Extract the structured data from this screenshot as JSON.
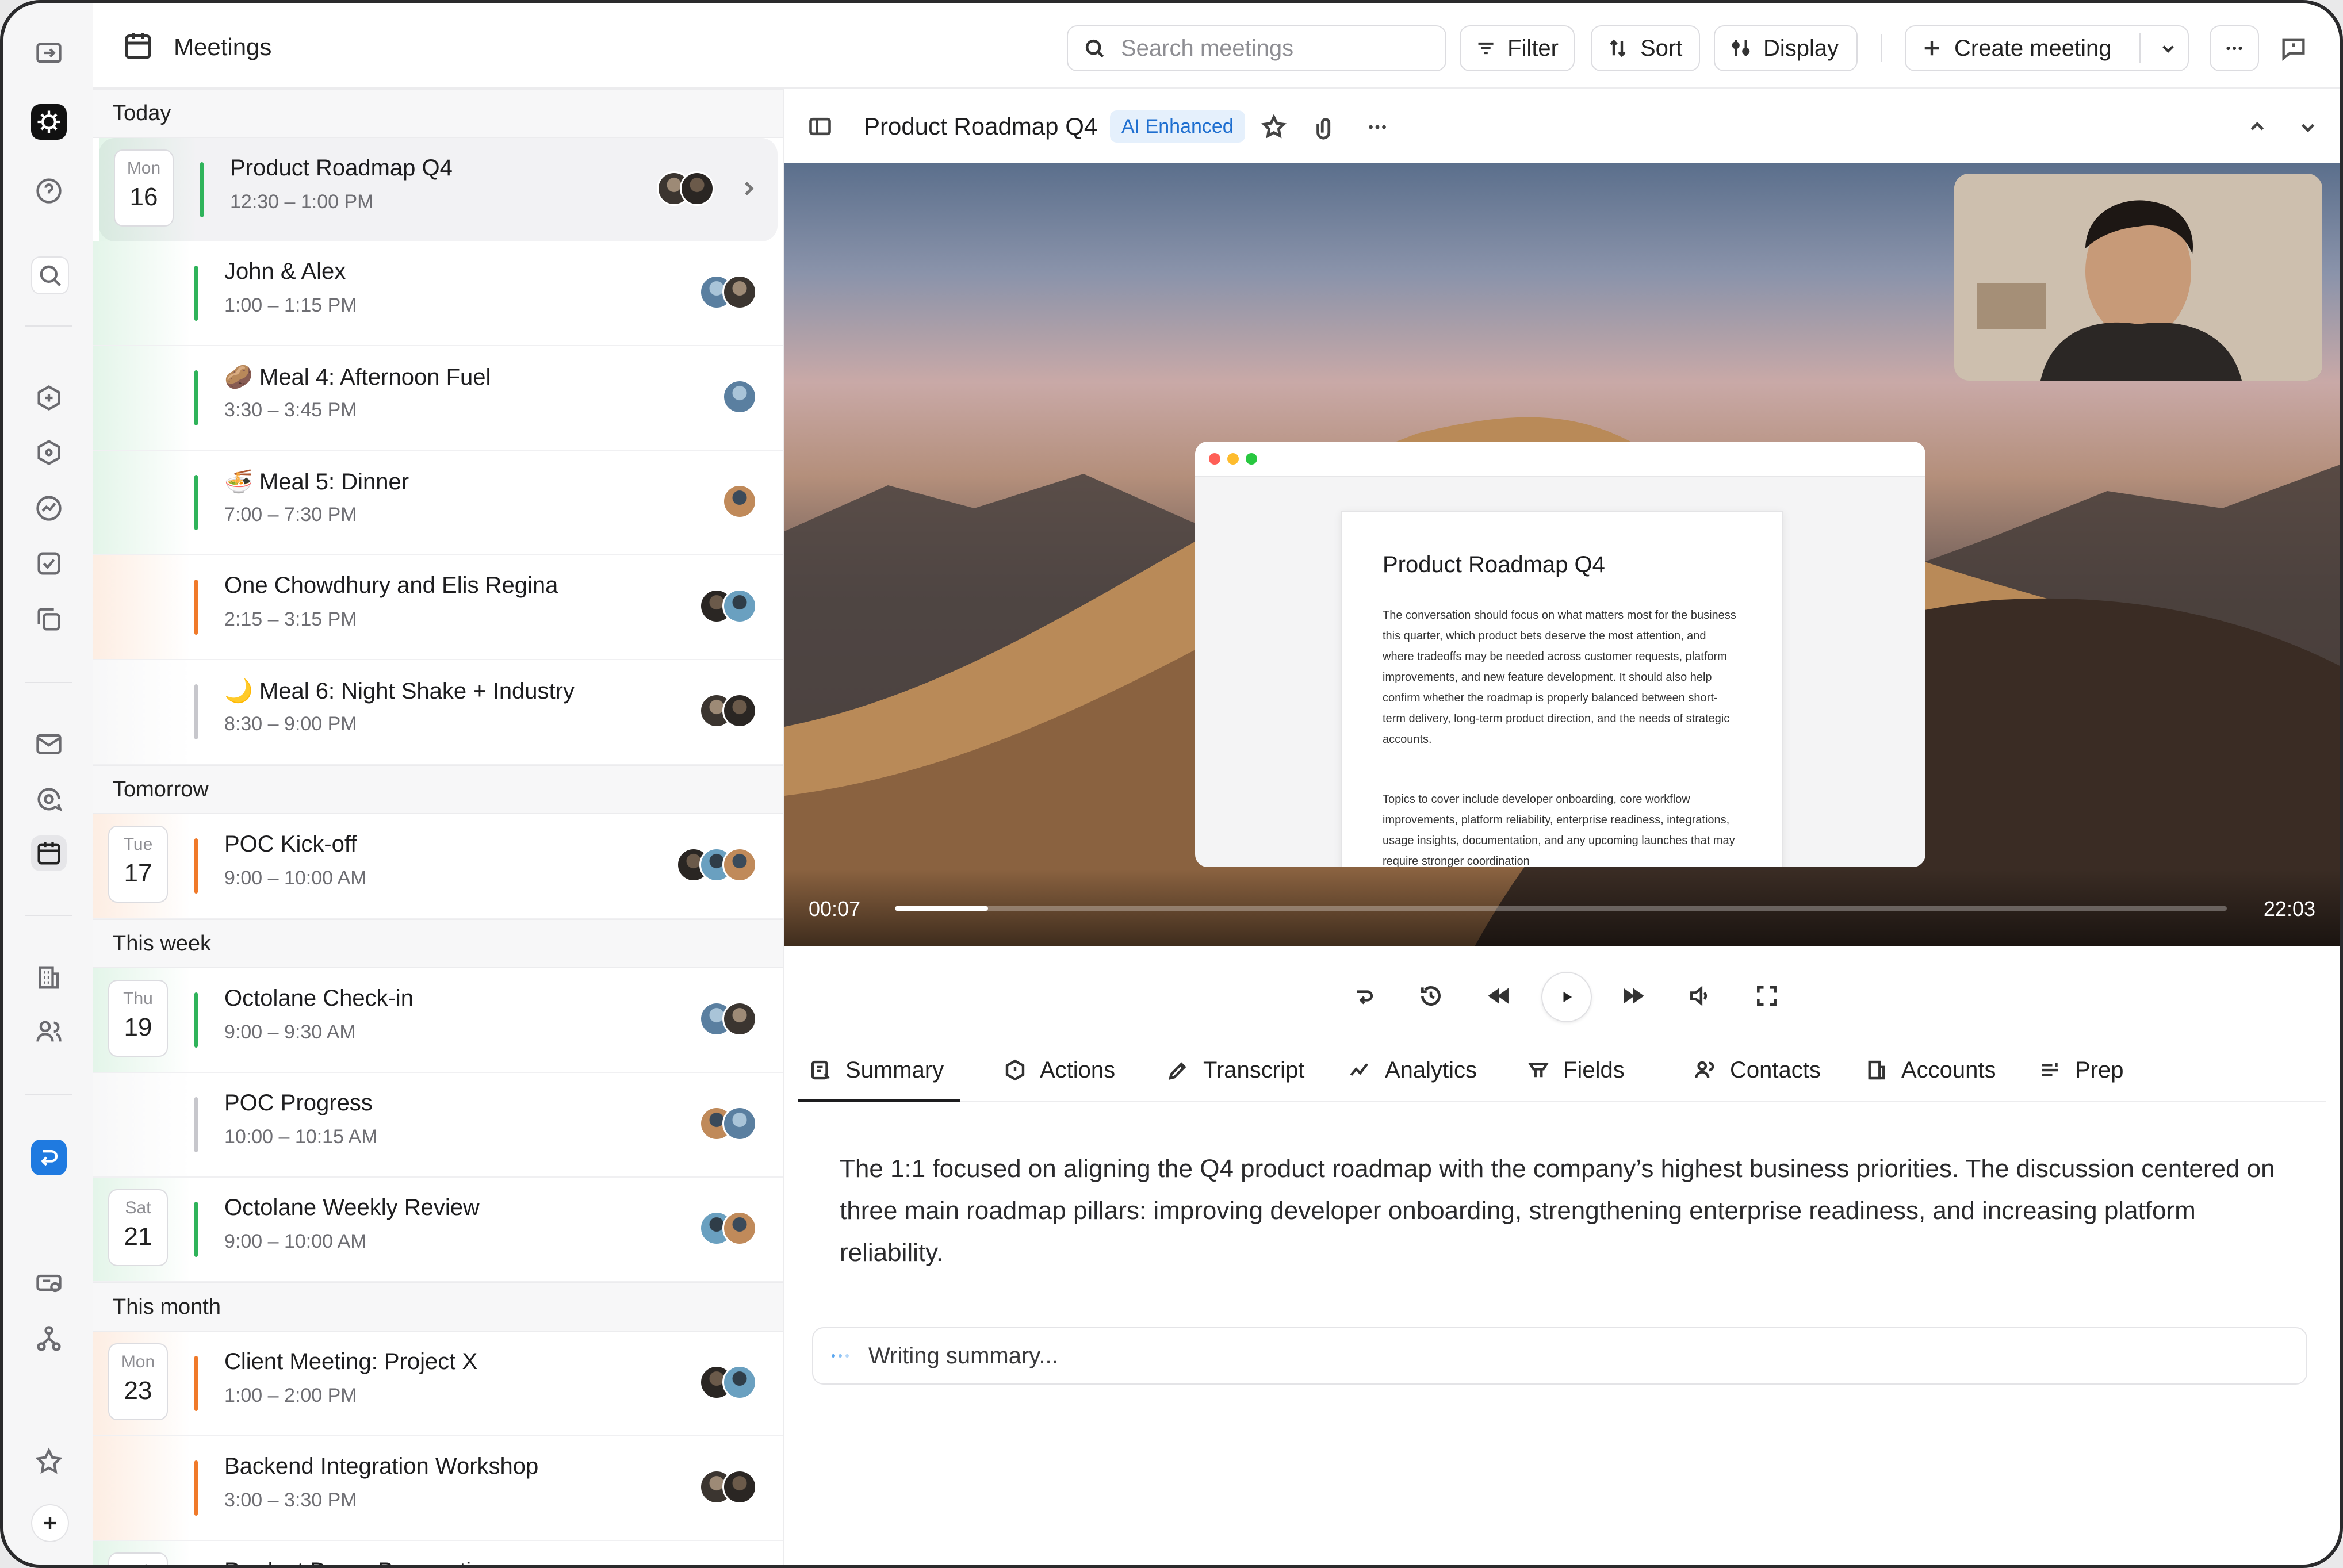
{
  "app": {
    "title": "Meetings"
  },
  "toolbar": {
    "search_placeholder": "Search meetings",
    "filter_label": "Filter",
    "sort_label": "Sort",
    "display_label": "Display",
    "create_label": "Create meeting"
  },
  "groups": [
    {
      "label": "Today",
      "meetings": [
        {
          "day": "Mon",
          "date": "16",
          "title": "Product Roadmap Q4",
          "time": "12:30 – 1:00 PM",
          "accent": "#2fb35a",
          "selected": true,
          "avatars": 2
        },
        {
          "title": "John & Alex",
          "time": "1:00 – 1:15 PM",
          "accent": "#2fb35a",
          "avatars": 2
        },
        {
          "title": "🥔 Meal 4: Afternoon Fuel",
          "time": "3:30 – 3:45 PM",
          "accent": "#2fb35a",
          "avatars": 1
        },
        {
          "title": "🍜 Meal 5: Dinner",
          "time": "7:00 – 7:30 PM",
          "accent": "#2fb35a",
          "avatars": 1
        },
        {
          "title": "One Chowdhury and Elis Regina",
          "time": "2:15 – 3:15 PM",
          "accent": "#f07a2a",
          "avatars": 2
        },
        {
          "title": "🌙 Meal 6: Night Shake + Industry",
          "time": "8:30 – 9:00 PM",
          "accent": "#c7c7cc",
          "avatars": 2
        }
      ]
    },
    {
      "label": "Tomorrow",
      "meetings": [
        {
          "day": "Tue",
          "date": "17",
          "title": "POC Kick-off",
          "time": "9:00 – 10:00 AM",
          "accent": "#f07a2a",
          "avatars": 3
        }
      ]
    },
    {
      "label": "This week",
      "meetings": [
        {
          "day": "Thu",
          "date": "19",
          "title": "Octolane Check-in",
          "time": "9:00 – 9:30 AM",
          "accent": "#2fb35a",
          "avatars": 2
        },
        {
          "title": "POC Progress",
          "time": "10:00 – 10:15 AM",
          "accent": "#c7c7cc",
          "avatars": 2
        },
        {
          "day": "Sat",
          "date": "21",
          "title": "Octolane Weekly Review",
          "time": "9:00 – 10:00 AM",
          "accent": "#2fb35a",
          "avatars": 2
        }
      ]
    },
    {
      "label": "This month",
      "meetings": [
        {
          "day": "Mon",
          "date": "23",
          "title": "Client Meeting: Project X",
          "time": "1:00 – 2:00 PM",
          "accent": "#f07a2a",
          "avatars": 2
        },
        {
          "title": "Backend Integration Workshop",
          "time": "3:00 – 3:30 PM",
          "accent": "#f07a2a",
          "avatars": 2
        },
        {
          "day": "Fri",
          "date": "",
          "title": "Product Demo Preparation",
          "time": "",
          "accent": "#2fb35a",
          "avatars": 2
        }
      ]
    }
  ],
  "detail": {
    "title": "Product Roadmap Q4",
    "badge": "AI Enhanced",
    "video": {
      "current_time": "00:07",
      "duration": "22:03",
      "progress": 0.07,
      "doc_title": "Product Roadmap Q4",
      "doc_para1": "The conversation should focus on what matters most for the business this quarter, which product bets deserve the most attention, and where tradeoffs may be needed across customer requests, platform improvements, and new feature development. It should also help confirm whether the roadmap is properly balanced between short-term delivery, long-term product direction, and the needs of strategic accounts.",
      "doc_para2": "Topics to cover include developer onboarding, core workflow improvements, platform reliability, enterprise readiness, integrations, usage insights, documentation, and any upcoming launches that may require stronger coordination"
    },
    "tabs": [
      {
        "label": "Summary",
        "icon": "summary-icon"
      },
      {
        "label": "Actions",
        "icon": "actions-icon"
      },
      {
        "label": "Transcript",
        "icon": "transcript-icon"
      },
      {
        "label": "Analytics",
        "icon": "analytics-icon"
      },
      {
        "label": "Fields",
        "icon": "fields-icon"
      },
      {
        "label": "Contacts",
        "icon": "contacts-icon"
      },
      {
        "label": "Accounts",
        "icon": "accounts-icon"
      },
      {
        "label": "Prep",
        "icon": "prep-icon"
      }
    ],
    "summary": "The 1:1 focused on aligning the Q4 product roadmap with the company’s highest business priorities. The discussion centered on three main roadmap pillars: improving developer onboarding, strengthening enterprise readiness, and increasing platform reliability.",
    "writing_status": "Writing summary..."
  }
}
